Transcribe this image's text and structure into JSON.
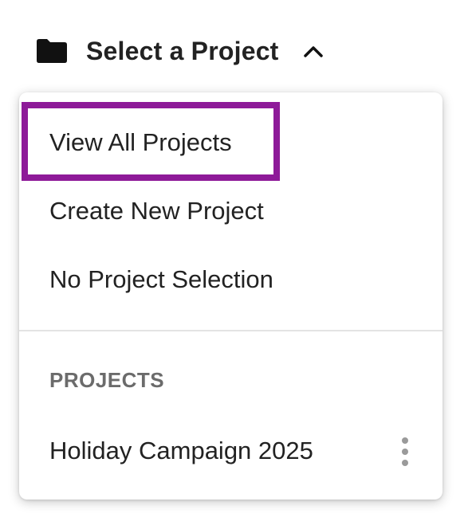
{
  "header": {
    "folder_icon": "folder-icon",
    "label": "Select a Project",
    "chevron_icon": "chevron-up-icon"
  },
  "menu": {
    "items": [
      {
        "label": "View All Projects",
        "highlighted": true
      },
      {
        "label": "Create New Project"
      },
      {
        "label": "No Project Selection"
      }
    ],
    "section_header": "PROJECTS",
    "projects": [
      {
        "name": "Holiday Campaign 2025",
        "more_icon": "more-vertical-icon"
      }
    ]
  },
  "colors": {
    "highlight": "#8e1a99",
    "text": "#222222",
    "section_header": "#6b6b6b"
  }
}
